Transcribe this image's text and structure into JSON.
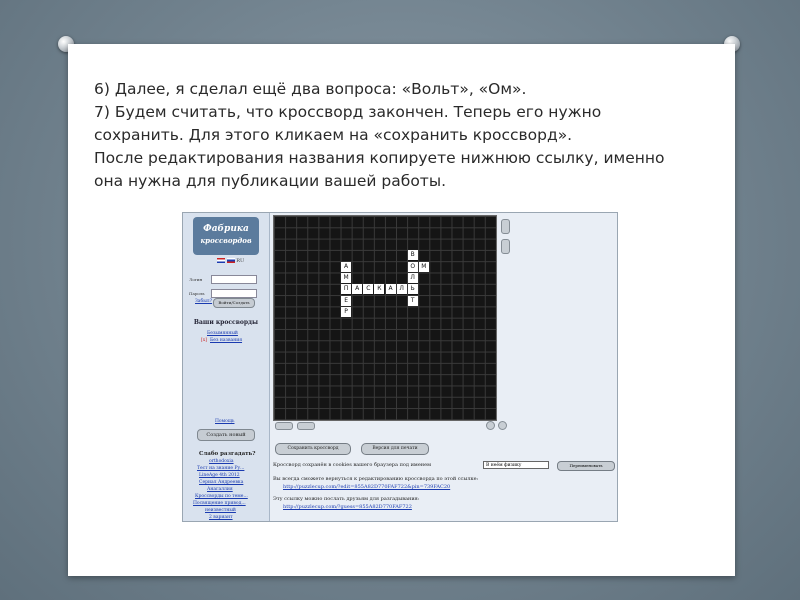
{
  "instructions": [
    "6) Далее, я сделал ещё два вопроса: «Вольт», «Ом».",
    "7) Будем считать, что кроссворд закончен. Теперь его нужно",
    "сохранить. Для этого кликаем на «сохранить кроссворд».",
    "После редактирования названия копируете нижнюю ссылку, именно",
    "она нужна для публикации вашей работы."
  ],
  "site": {
    "logo_line1": "Фабрика",
    "logo_line2": "кроссвордов",
    "lang": "RU",
    "login_label": "Логин",
    "password_label": "Пароль",
    "forgot_link": "Забыл?",
    "login_button": "Войти/Создать",
    "section_title": "Ваши кроссворды",
    "crossword_link": "Безымянный",
    "crossword_link2": "Без названия",
    "marker": "[x]",
    "help_link": "Помощь",
    "create_button": "Создать новый",
    "solve_title": "Слабо разгадать?",
    "solve_links": [
      "orthodoxia",
      "Тест на знание Ру...",
      "LineAge 4th 2012",
      "Сериал Андреевка",
      "Анагаллия",
      "Кроссворды по теме...",
      "Посвящение привод...",
      "неизвестный",
      "2 вариант"
    ]
  },
  "grid": {
    "letters": [
      {
        "ch": "В",
        "c": 12,
        "r": 3
      },
      {
        "ch": "А",
        "c": 6,
        "r": 4
      },
      {
        "ch": "О",
        "c": 12,
        "r": 4
      },
      {
        "ch": "М",
        "c": 13,
        "r": 4
      },
      {
        "ch": "М",
        "c": 6,
        "r": 5
      },
      {
        "ch": "Л",
        "c": 12,
        "r": 5
      },
      {
        "ch": "П",
        "c": 6,
        "r": 6
      },
      {
        "ch": "А",
        "c": 7,
        "r": 6
      },
      {
        "ch": "С",
        "c": 8,
        "r": 6
      },
      {
        "ch": "К",
        "c": 9,
        "r": 6
      },
      {
        "ch": "А",
        "c": 10,
        "r": 6
      },
      {
        "ch": "Л",
        "c": 11,
        "r": 6
      },
      {
        "ch": "Ь",
        "c": 12,
        "r": 6
      },
      {
        "ch": "Е",
        "c": 6,
        "r": 7
      },
      {
        "ch": "Т",
        "c": 12,
        "r": 7
      },
      {
        "ch": "Р",
        "c": 6,
        "r": 8
      }
    ]
  },
  "actions": {
    "save_button": "Сохранить кроссворд",
    "print_button": "Версия для печати",
    "rename_button": "Переименовать",
    "name_value": "В неём физику",
    "saved_text": "Кроссворд сохранён в cookies вашего браузера под именем",
    "edit_text": "Вы всегда сможете вернуться к редактированию кроссворда по этой ссылке:",
    "edit_url": "http://puzzlecup.com/?edit=855A82D770FAF722&pin=739FAC20",
    "share_text": "Эту ссылку можно послать друзьям для разгадывания:",
    "share_url": "http://puzzlecup.com/?guess=855A82D770FAF722"
  }
}
